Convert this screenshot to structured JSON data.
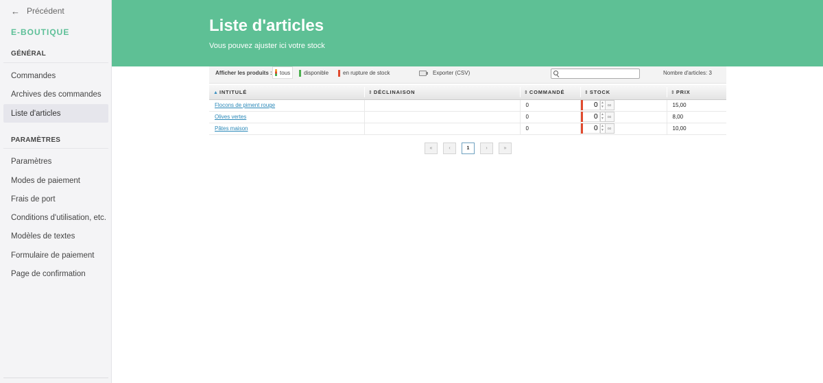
{
  "sidebar": {
    "back_label": "Précédent",
    "brand": "E-BOUTIQUE",
    "sections": [
      {
        "title": "GÉNÉRAL",
        "items": [
          "Commandes",
          "Archives des commandes",
          "Liste d'articles"
        ]
      },
      {
        "title": "PARAMÈTRES",
        "items": [
          "Paramètres",
          "Modes de paiement",
          "Frais de port",
          "Conditions d'utilisation, etc.",
          "Modèles de textes",
          "Formulaire de paiement",
          "Page de confirmation"
        ]
      }
    ],
    "active_item": "Liste d'articles"
  },
  "header": {
    "title": "Liste d'articles",
    "subtitle": "Vous pouvez ajuster ici votre stock",
    "color": "#5ec095"
  },
  "toolbar": {
    "filter_label": "Afficher les produits :",
    "filters": [
      "tous",
      "disponible",
      "en rupture de stock"
    ],
    "active_filter": "tous",
    "export_label": "Exporter (CSV)",
    "search_placeholder": "",
    "count_label": "Nombre d'articles: 3"
  },
  "table": {
    "columns": [
      "INTITULÉ",
      "DÉCLINAISON",
      "COMMANDÉ",
      "STOCK",
      "PRIX"
    ],
    "sorted_column": "INTITULÉ",
    "rows": [
      {
        "name": "Flocons de piment rouge",
        "variant": "",
        "ordered": "0",
        "stock": "0",
        "price": "15,00"
      },
      {
        "name": "Olives vertes",
        "variant": "",
        "ordered": "0",
        "stock": "0",
        "price": "8,00"
      },
      {
        "name": "Pâtes maison",
        "variant": "",
        "ordered": "0",
        "stock": "0",
        "price": "10,00"
      }
    ]
  },
  "pagination": {
    "first": "«",
    "prev": "‹",
    "current": "1",
    "next": "›",
    "last": "»"
  }
}
